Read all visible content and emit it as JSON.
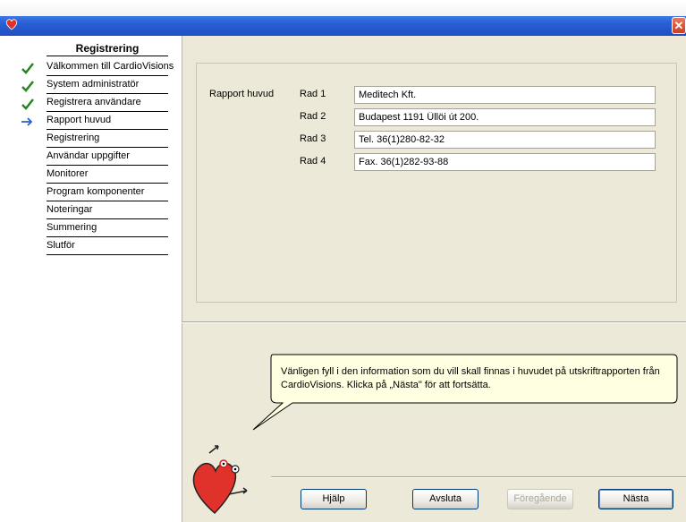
{
  "window": {
    "close_label": "✕"
  },
  "sidebar": {
    "title": "Registrering",
    "items": [
      {
        "label": "Välkommen till CardioVisions",
        "status": "done"
      },
      {
        "label": "System administratör",
        "status": "done"
      },
      {
        "label": "Registrera användare",
        "status": "done"
      },
      {
        "label": "Rapport huvud",
        "status": "current"
      },
      {
        "label": "Registrering",
        "status": "pending"
      },
      {
        "label": "Användar uppgifter",
        "status": "pending"
      },
      {
        "label": "Monitorer",
        "status": "pending"
      },
      {
        "label": "Program komponenter",
        "status": "pending"
      },
      {
        "label": "Noteringar",
        "status": "pending"
      },
      {
        "label": "Summering",
        "status": "pending"
      },
      {
        "label": "Slutför",
        "status": "pending"
      }
    ]
  },
  "form": {
    "section_label": "Rapport huvud",
    "rows": [
      {
        "label": "Rad 1",
        "value": "Meditech Kft."
      },
      {
        "label": "Rad 2",
        "value": "Budapest 1191 Üllöi út 200."
      },
      {
        "label": "Rad 3",
        "value": "Tel. 36(1)280-82-32"
      },
      {
        "label": "Rad 4",
        "value": "Fax. 36(1)282-93-88"
      }
    ]
  },
  "help": {
    "bubble_text": "Vänligen fyll i den information som du vill skall finnas i huvudet på utskriftrapporten från CardioVisions.  Klicka på „Nästa\" för att fortsätta."
  },
  "buttons": {
    "help": "Hjälp",
    "cancel": "Avsluta",
    "back": "Föregående",
    "next": "Nästa"
  },
  "colors": {
    "check": "#1e8a1e",
    "arrow": "#2a5fd6",
    "heart": "#e0322a"
  }
}
